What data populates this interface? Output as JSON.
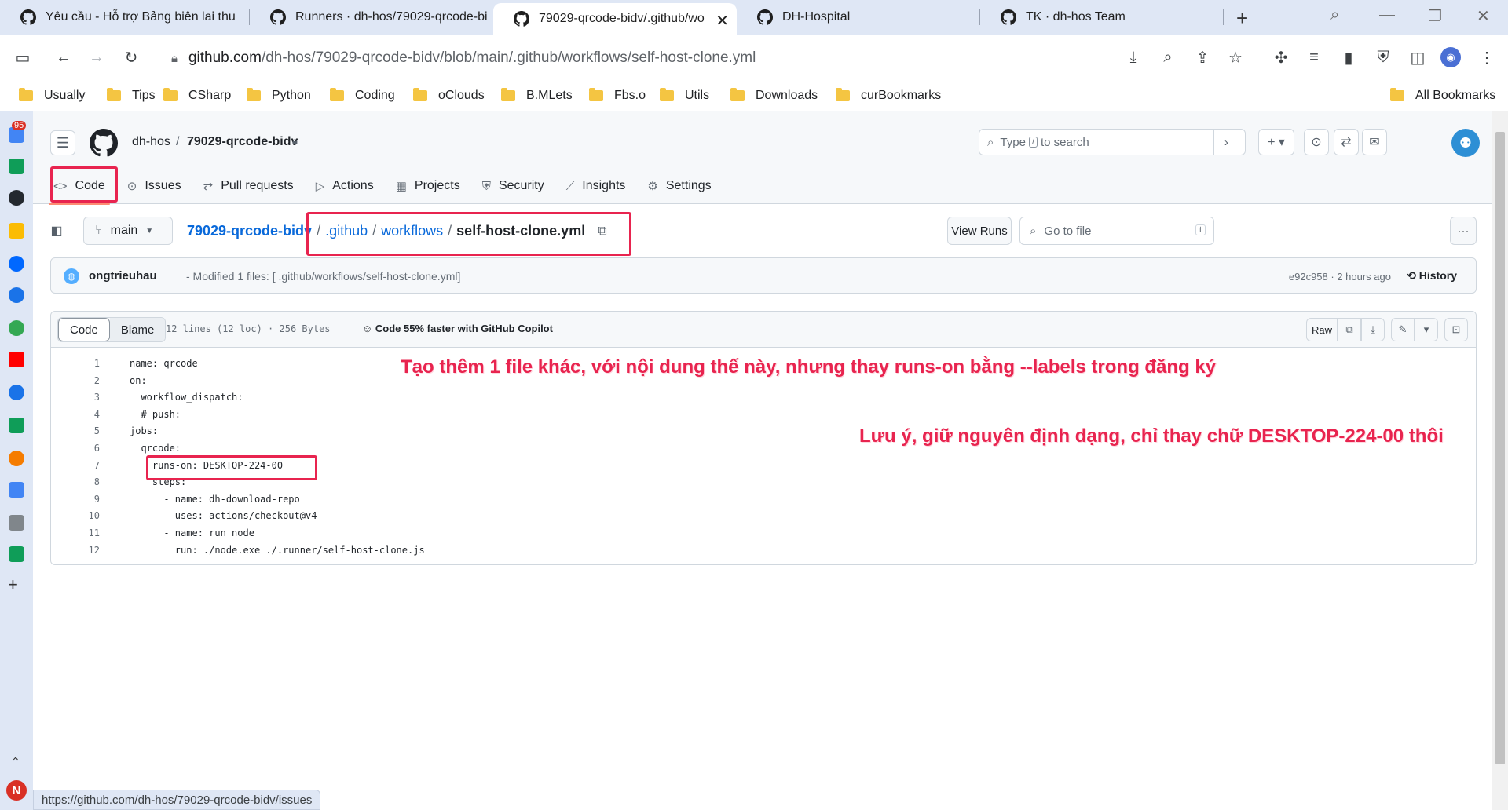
{
  "browser": {
    "tabs": [
      {
        "title": "Yêu cầu - Hỗ trợ Bảng biên lai thu"
      },
      {
        "title": "Runners · dh-hos/79029-qrcode-bi"
      },
      {
        "title": "79029-qrcode-bidv/.github/wo"
      },
      {
        "title": "DH-Hospital"
      },
      {
        "title": "TK · dh-hos Team"
      }
    ],
    "url_host": "github.com",
    "url_path": "/dh-hos/79029-qrcode-bidv/blob/main/.github/workflows/self-host-clone.yml",
    "bookmarks": [
      "Usually",
      "Tips",
      "CSharp",
      "Python",
      "Coding",
      "oClouds",
      "B.MLets",
      "Fbs.o",
      "Utils",
      "Downloads",
      "curBookmarks"
    ],
    "all_bookmarks": "All Bookmarks",
    "side_badge": "95",
    "side_profile": "N",
    "status_url": "https://github.com/dh-hos/79029-qrcode-bidv/issues"
  },
  "github": {
    "owner": "dh-hos",
    "repo": "79029-qrcode-bidv",
    "search_prefix": "Type",
    "search_key": "/",
    "search_suffix": "to search",
    "nav": [
      "Code",
      "Issues",
      "Pull requests",
      "Actions",
      "Projects",
      "Security",
      "Insights",
      "Settings"
    ],
    "branch": "main",
    "path": {
      "repo": "79029-qrcode-bidv",
      "dir1": ".github",
      "dir2": "workflows",
      "file": "self-host-clone.yml"
    },
    "view_runs": "View Runs",
    "goto_placeholder": "Go to file",
    "goto_key": "t",
    "commit": {
      "author": "ongtrieuhau",
      "message": "- Modified 1 files: [ .github/workflows/self-host-clone.yml]",
      "meta": "e92c958 · 2 hours ago",
      "history": "History"
    },
    "code_tabs": {
      "code": "Code",
      "blame": "Blame"
    },
    "file_info": "12 lines (12 loc) · 256 Bytes",
    "copilot": "Code 55% faster with GitHub Copilot",
    "raw": "Raw",
    "lines": [
      "name: qrcode",
      "on:",
      "  workflow_dispatch:",
      "  # push:",
      "jobs:",
      "  qrcode:",
      "    runs-on: DESKTOP-224-00",
      "    steps:",
      "      - name: dh-download-repo",
      "        uses: actions/checkout@v4",
      "      - name: run node",
      "        run: ./node.exe ./.runner/self-host-clone.js"
    ]
  },
  "annotations": {
    "note1": "Tạo thêm 1 file khác, với nội dung thế này, nhưng thay runs-on bằng --labels trong đăng ký",
    "note2": "Lưu ý, giữ nguyên định dạng, chỉ thay chữ DESKTOP-224-00 thôi",
    "color": "#e8244f"
  }
}
